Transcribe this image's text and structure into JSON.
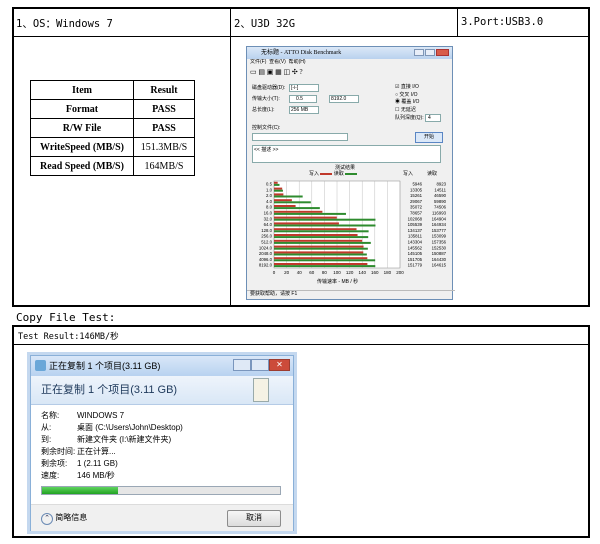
{
  "header": {
    "os": "1、OS：Windows 7",
    "drive": "2、U3D 32G",
    "port": "3.Port:USB3.0"
  },
  "result_table": {
    "columns": [
      "Item",
      "Result"
    ],
    "rows": [
      [
        "Format",
        "PASS"
      ],
      [
        "R/W File",
        "PASS"
      ],
      [
        "WriteSpeed (MB/S)",
        "151.3MB/S"
      ],
      [
        "Read Speed (MB/S)",
        "164MB/S"
      ]
    ]
  },
  "atto": {
    "title": "无标题 - ATTO Disk Benchmark",
    "menu": [
      "文件(F)",
      "查看(V)",
      "帮助(H)"
    ],
    "drive_label": "磁盘驱动器(D):",
    "drive_value": "[-i-]",
    "transfer_label": "传输大小(T):",
    "transfer_from": "0.5",
    "transfer_to": "8192.0",
    "length_label": "总长度(L):",
    "length_value": "256 MB",
    "options": [
      "直接 I/O",
      "交叉 I/O",
      "覆盖 I/O",
      "无延迟"
    ],
    "queue_label": "队列深度(Q):",
    "queue_value": "4",
    "control_label": "控制文件(C):",
    "start_button": "开始",
    "description": "<< 描述 >>",
    "legend_title": "测试结果",
    "legend_write": "写入",
    "legend_read": "读取",
    "col_write": "写入",
    "col_read": "读取",
    "x_axis_label": "传输速率 - MB / 秒",
    "status": "要获取帮助，请按 F1",
    "sizes": [
      "0.5",
      "1.0",
      "2.0",
      "4.0",
      "8.0",
      "16.0",
      "32.0",
      "64.0",
      "128.0",
      "256.0",
      "512.0",
      "1024.0",
      "2048.0",
      "4096.0",
      "8192.0"
    ],
    "write_vals": [
      "5946",
      "13305",
      "15261",
      "29067",
      "35072",
      "78657",
      "102068",
      "105539",
      "134137",
      "135811",
      "143304",
      "145562",
      "145105",
      "151705",
      "151779"
    ],
    "read_vals": [
      "8923",
      "14511",
      "46590",
      "59890",
      "74506",
      "116993",
      "164904",
      "164934",
      "153777",
      "153099",
      "157356",
      "152530",
      "150887",
      "164430",
      "164615"
    ],
    "x_ticks": [
      "0",
      "20",
      "40",
      "60",
      "80",
      "100",
      "120",
      "140",
      "160",
      "180",
      "200"
    ]
  },
  "copy_test": {
    "heading": "Copy File Test:",
    "result": "Test Result:146MB/秒",
    "dialog_title": "正在复制 1 个项目(3.11 GB)",
    "dialog_header": "正在复制 1 个项目(3.11 GB)",
    "rows": [
      {
        "label": "名称:",
        "value": "WINDOWS 7"
      },
      {
        "label": "从:",
        "value": "桌面 (C:\\Users\\John\\Desktop)"
      },
      {
        "label": "到:",
        "value": "新建文件夹 (I:\\新建文件夹)"
      },
      {
        "label": "剩余时间:",
        "value": "正在计算..."
      },
      {
        "label": "剩余项:",
        "value": "1 (2.11 GB)"
      },
      {
        "label": "速度:",
        "value": "146 MB/秒"
      }
    ],
    "progress": 0.32,
    "details_label": "简略信息",
    "cancel_label": "取消"
  }
}
